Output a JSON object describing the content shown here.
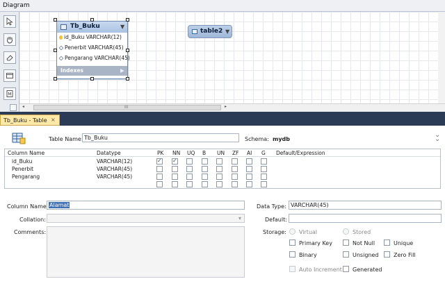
{
  "diagram": {
    "title": "Diagram",
    "table": {
      "name": "Tb_Buku",
      "columns": [
        {
          "text": "id_Buku VARCHAR(12)",
          "key": "primary"
        },
        {
          "text": "Penerbit VARCHAR(45)",
          "key": "none"
        },
        {
          "text": "Pengarang VARCHAR(45)",
          "key": "none"
        }
      ],
      "indexes_label": "Indexes"
    },
    "table2_name": "table2",
    "scroll_grip": "III"
  },
  "tab": {
    "label": "Tb_Buku - Table",
    "close": "×"
  },
  "editor": {
    "table_name_label": "Table Name:",
    "table_name_value": "Tb_Buku",
    "schema_label": "Schema:",
    "schema_value": "mydb",
    "grid_headers": [
      "Column Name",
      "Datatype",
      "PK",
      "NN",
      "UQ",
      "B",
      "UN",
      "ZF",
      "AI",
      "G",
      "Default/Expression"
    ],
    "rows": [
      {
        "name": "id_Buku",
        "type": "VARCHAR(12)",
        "pk": true,
        "nn": true
      },
      {
        "name": "Penerbit",
        "type": "VARCHAR(45)",
        "pk": false,
        "nn": false
      },
      {
        "name": "Pengarang",
        "type": "VARCHAR(45)",
        "pk": false,
        "nn": false
      },
      {
        "name": "",
        "type": "",
        "pk": false,
        "nn": false
      }
    ],
    "column_name_label": "Column Name:",
    "column_name_value": "Alamat",
    "collation_label": "Collation:",
    "comments_label": "Comments:",
    "data_type_label": "Data Type:",
    "data_type_value": "VARCHAR(45)",
    "default_label": "Default:",
    "storage_label": "Storage:",
    "storage_options": [
      "Virtual",
      "Stored"
    ],
    "flags": [
      "Primary Key",
      "Not Null",
      "Unique",
      "Binary",
      "Unsigned",
      "Zero Fill",
      "Auto Increment",
      "Generated"
    ]
  }
}
